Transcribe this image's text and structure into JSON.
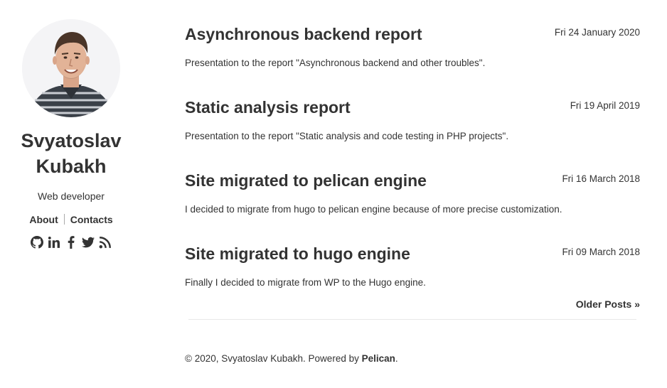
{
  "author": {
    "name": "Svyatoslav Kubakh",
    "role": "Web developer"
  },
  "nav": {
    "about": "About",
    "contacts": "Contacts"
  },
  "social": [
    "github-icon",
    "linkedin-icon",
    "facebook-icon",
    "twitter-icon",
    "rss-icon"
  ],
  "posts": [
    {
      "title": "Asynchronous backend report",
      "date": "Fri 24 January 2020",
      "summary": "Presentation to the report \"Asynchronous backend and other troubles\"."
    },
    {
      "title": "Static analysis report",
      "date": "Fri 19 April 2019",
      "summary": "Presentation to the report \"Static analysis and code testing in PHP projects\"."
    },
    {
      "title": "Site migrated to pelican engine",
      "date": "Fri 16 March 2018",
      "summary": "I decided to migrate from hugo to pelican engine because of more precise customization."
    },
    {
      "title": "Site migrated to hugo engine",
      "date": "Fri 09 March 2018",
      "summary": "Finally I decided to migrate from WP to the Hugo engine."
    }
  ],
  "pagination": {
    "older": "Older Posts »"
  },
  "footer": {
    "text": "© 2020, Svyatoslav Kubakh. Powered by ",
    "engine": "Pelican",
    "end": "."
  }
}
